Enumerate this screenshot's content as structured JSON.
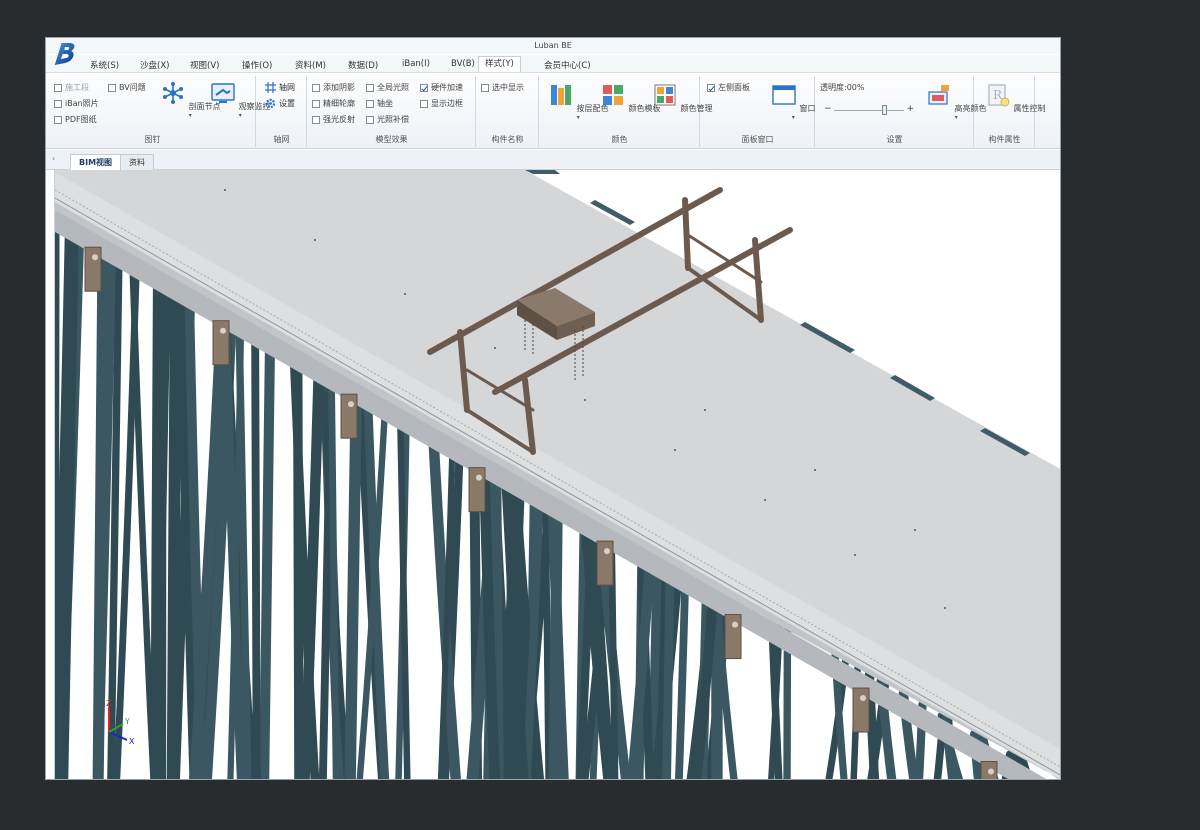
{
  "app": {
    "title": "Luban BE",
    "logo_letter": "B"
  },
  "menu": {
    "items": [
      "系统(S)",
      "沙盘(X)",
      "视图(V)",
      "操作(O)",
      "资料(M)",
      "数据(D)",
      "iBan(I)",
      "BV(B)",
      "样式(Y)",
      "会员中心(C)"
    ],
    "active": "样式(Y)"
  },
  "ribbon": {
    "groups": {
      "tudinq": "图钉",
      "zhouwang": "轴网",
      "moxing": "模型效果",
      "goujian_mingcheng": "构件名称",
      "yanse": "颜色",
      "mianban": "面板窗口",
      "shezhi": "设置",
      "goujian_shuxing": "构件属性"
    },
    "tudinq": {
      "checks": [
        {
          "label": "施工段",
          "checked": false,
          "disabled": true
        },
        {
          "label": "BV问题",
          "checked": false,
          "disabled": false
        },
        {
          "label": "iBan照片",
          "checked": false,
          "disabled": false
        },
        {
          "label": "PDF图纸",
          "checked": false,
          "disabled": false
        }
      ],
      "btn_node": "剖面节点",
      "btn_monitor": "观察监控"
    },
    "zhouwang": {
      "btn_axis": "轴网",
      "btn_set": "设置"
    },
    "moxing": {
      "checks": [
        {
          "label": "添加阴影",
          "checked": false
        },
        {
          "label": "全局光照",
          "checked": false
        },
        {
          "label": "硬件加速",
          "checked": true
        },
        {
          "label": "精细轮廓",
          "checked": false
        },
        {
          "label": "轴坐",
          "checked": false
        },
        {
          "label": "显示边框",
          "checked": false
        },
        {
          "label": "强光反射",
          "checked": false
        },
        {
          "label": "光照补偿",
          "checked": false
        }
      ]
    },
    "goujian_mingcheng": {
      "check": {
        "label": "选中显示",
        "checked": false
      }
    },
    "yanse": {
      "btn1": "按层配色",
      "btn2": "颜色模板",
      "btn3": "颜色管理"
    },
    "mianban": {
      "check": {
        "label": "左侧面板",
        "checked": true
      },
      "btn": "窗口"
    },
    "shezhi": {
      "transparency": "透明度:00%",
      "transparency_value": 0.72,
      "btn": "高亮颜色"
    },
    "goujian_shuxing": {
      "btn": "属性控制"
    }
  },
  "tabs": [
    "BIM视图",
    "资料"
  ],
  "active_tab": "BIM视图",
  "viewport": {
    "axis_labels": {
      "z": "Z",
      "x": "X",
      "y": "Y"
    }
  },
  "colors": {
    "background": "#282c2f",
    "deck": "#d7d9db",
    "piles": "#3b5761",
    "gantry": "#6b5a4d",
    "accent_blue": "#1f3f6c"
  }
}
